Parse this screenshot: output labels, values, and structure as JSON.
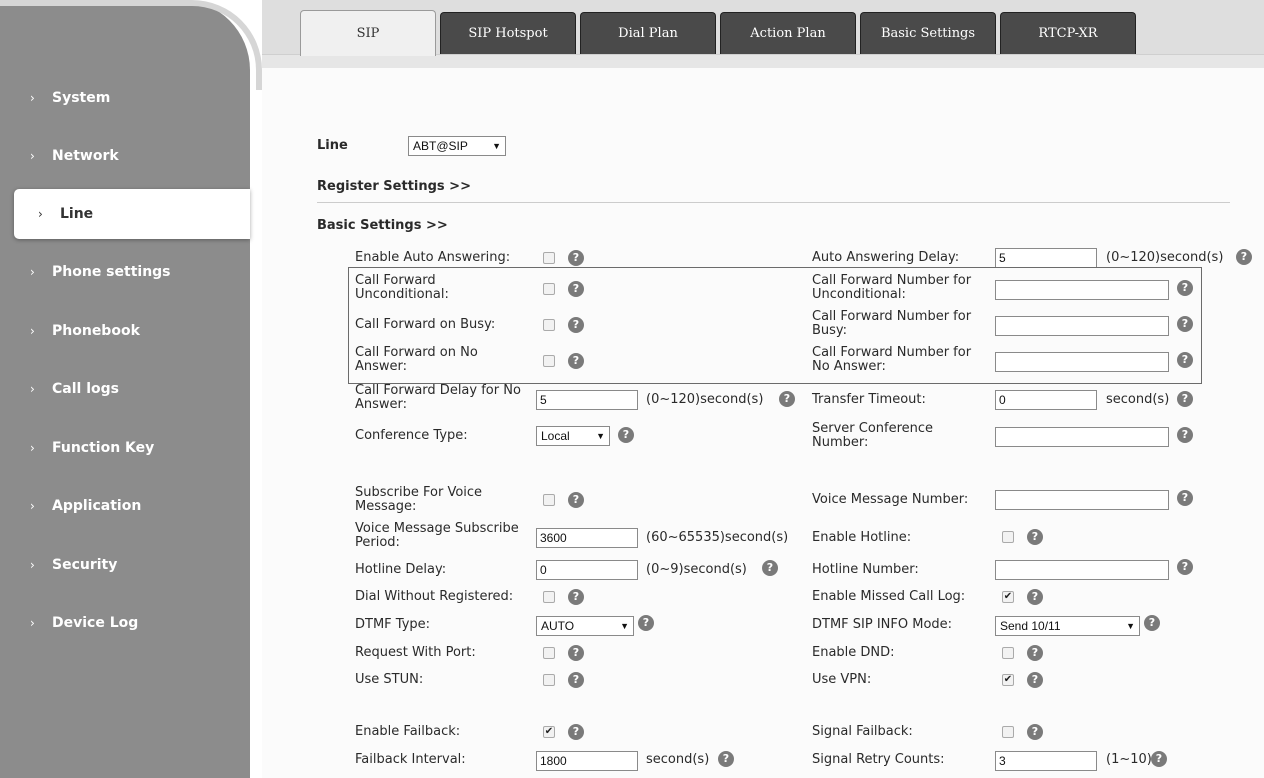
{
  "nav": [
    {
      "label": "System",
      "active": false
    },
    {
      "label": "Network",
      "active": false
    },
    {
      "label": "Line",
      "active": true
    },
    {
      "label": "Phone settings",
      "active": false
    },
    {
      "label": "Phonebook",
      "active": false
    },
    {
      "label": "Call logs",
      "active": false
    },
    {
      "label": "Function Key",
      "active": false
    },
    {
      "label": "Application",
      "active": false
    },
    {
      "label": "Security",
      "active": false
    },
    {
      "label": "Device Log",
      "active": false
    }
  ],
  "tabs": [
    {
      "label": "SIP",
      "active": true
    },
    {
      "label": "SIP Hotspot",
      "active": false
    },
    {
      "label": "Dial Plan",
      "active": false
    },
    {
      "label": "Action Plan",
      "active": false
    },
    {
      "label": "Basic Settings",
      "active": false
    },
    {
      "label": "RTCP-XR",
      "active": false
    }
  ],
  "line": {
    "label": "Line",
    "value": "ABT@SIP"
  },
  "sections": {
    "register": "Register Settings >>",
    "basic": "Basic Settings >>"
  },
  "fields": {
    "auto_answer": {
      "label": "Enable Auto Answering:",
      "checked": false
    },
    "auto_answer_delay": {
      "label": "Auto Answering Delay:",
      "value": "5",
      "unit": "(0~120)second(s)"
    },
    "cf_uncond": {
      "label": "Call Forward Unconditional:",
      "checked": false
    },
    "cf_uncond_num": {
      "label": "Call Forward Number for Unconditional:",
      "value": ""
    },
    "cf_busy": {
      "label": "Call Forward on Busy:",
      "checked": false
    },
    "cf_busy_num": {
      "label": "Call Forward Number for Busy:",
      "value": ""
    },
    "cf_noans": {
      "label": "Call Forward on No Answer:",
      "checked": false
    },
    "cf_noans_num": {
      "label": "Call Forward Number for No Answer:",
      "value": ""
    },
    "cf_delay": {
      "label": "Call Forward Delay for No Answer:",
      "value": "5",
      "unit": "(0~120)second(s)"
    },
    "transfer_timeout": {
      "label": "Transfer Timeout:",
      "value": "0",
      "unit": "second(s)"
    },
    "conf_type": {
      "label": "Conference Type:",
      "value": "Local"
    },
    "server_conf_num": {
      "label": "Server Conference Number:",
      "value": ""
    },
    "sub_voice": {
      "label": "Subscribe For Voice Message:",
      "checked": false
    },
    "voice_msg_num": {
      "label": "Voice Message Number:",
      "value": ""
    },
    "vm_sub_period": {
      "label": "Voice Message Subscribe Period:",
      "value": "3600",
      "unit": "(60~65535)second(s)"
    },
    "hotline": {
      "label": "Enable Hotline:",
      "checked": false
    },
    "hotline_delay": {
      "label": "Hotline Delay:",
      "value": "0",
      "unit": "(0~9)second(s)"
    },
    "hotline_num": {
      "label": "Hotline Number:",
      "value": ""
    },
    "dial_wo_reg": {
      "label": "Dial Without Registered:",
      "checked": false
    },
    "missed_log": {
      "label": "Enable Missed Call Log:",
      "checked": true
    },
    "dtmf_type": {
      "label": "DTMF Type:",
      "value": "AUTO"
    },
    "dtmf_sip_info": {
      "label": "DTMF SIP INFO Mode:",
      "value": "Send 10/11"
    },
    "req_port": {
      "label": "Request With Port:",
      "checked": false
    },
    "dnd": {
      "label": "Enable DND:",
      "checked": false
    },
    "stun": {
      "label": "Use STUN:",
      "checked": false
    },
    "vpn": {
      "label": "Use VPN:",
      "checked": true
    },
    "failback": {
      "label": "Enable Failback:",
      "checked": true
    },
    "signal_failback": {
      "label": "Signal Failback:",
      "checked": false
    },
    "failback_interval": {
      "label": "Failback Interval:",
      "value": "1800",
      "unit": "second(s)"
    },
    "signal_retry": {
      "label": "Signal Retry Counts:",
      "value": "3",
      "unit": "(1~10)"
    }
  },
  "help_glyph": "?",
  "check_glyph": "✔",
  "chevron_glyph": "›",
  "dropdown_glyph": "▼"
}
